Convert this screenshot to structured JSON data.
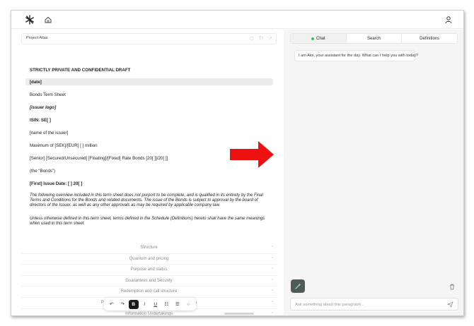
{
  "document": {
    "title": "Project Atlas",
    "lines": [
      "STRICTLY PRIVATE AND CONFIDENTIAL DRAFT",
      "[date]",
      "Bonds Term Sheet",
      "[issuer logo]",
      "ISIN: SE[      ]",
      "[name of the issuer]",
      "Maximum of [SEK]/[EUR] [ ] million",
      "[Senior] [Secured/Unsecured] [Floating]/[Fixed] Rate Bonds [20[    ]]/20[    ]]",
      "(the “Bonds”)",
      "[First] Issue Date: [    ] 20[    ]"
    ],
    "paragraph_1": "The following overview included in this term sheet does not purport to be complete, and is qualified in its entirety by the Final Terms and Conditions for the Bonds and related documents. The issue of the Bonds is subject to approval by the board of directors of the Issuer, as well as any other approvals as may be required by applicable company law.",
    "paragraph_2": "Unless otherwise defined in this term sheet, terms defined in the Schedule (Definitions) hereto shall have the same meanings when used in this term sheet."
  },
  "sections": [
    "Structure",
    "Quantum and pricing",
    "Purpose and status",
    "Guarantees and Security",
    "Redemption and call structure",
    "Proceeds Account and distribution of Net Proceeds",
    "Information Undertakings"
  ],
  "toolbar": {
    "undo": "↶",
    "redo": "↷",
    "bold": "B",
    "italic": "I",
    "underline": "U",
    "bullet_list": "☷",
    "numbered_list": "☰",
    "search": "○"
  },
  "chat": {
    "tabs": [
      "Chat",
      "Search",
      "Definitions"
    ],
    "active_tab": "Chat",
    "greeting": "I am Aloi, your assistant for the day. What can I help you with today?",
    "input_placeholder": "Ask something about this paragraph...",
    "active_dot_color": "#3bbf6b"
  },
  "icons": {
    "logo": "snowflake-logo-icon",
    "home": "home-icon",
    "user": "user-icon",
    "magic": "magic-wand-icon",
    "trash": "trash-icon",
    "send": "send-icon",
    "annotation_arrow": "red-arrow-icon"
  },
  "colors": {
    "arrow": "#ee1111",
    "magic_button": "#4f5b59"
  }
}
